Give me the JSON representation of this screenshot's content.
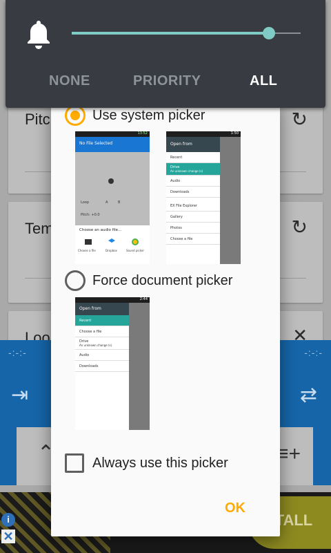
{
  "volume_panel": {
    "level": 0.86,
    "modes": [
      {
        "label": "NONE",
        "selected": false
      },
      {
        "label": "PRIORITY",
        "selected": false
      },
      {
        "label": "ALL",
        "selected": true
      }
    ],
    "accent": "#80cbc4"
  },
  "background": {
    "cards": [
      {
        "label": "Pitc",
        "icon": "refresh-icon"
      },
      {
        "label": "Tem",
        "icon": "refresh-icon"
      },
      {
        "label": "Loo",
        "icon": "close-icon"
      }
    ],
    "ad": {
      "install_label": "STALL"
    }
  },
  "dialog": {
    "options": [
      {
        "label": "Use system picker",
        "checked": true
      },
      {
        "label": "Force document picker",
        "checked": false
      }
    ],
    "checkbox_label": "Always use this picker",
    "ok_label": "OK",
    "accent": "#ffab00"
  },
  "previews": {
    "system_left": {
      "status_time": "13:52",
      "title": "No File Selected",
      "loop_label": "Loop",
      "a_label": "A",
      "b_label": "B",
      "pitch_label": "Pitch: +0.0",
      "chooser_title": "Choose an audio file...",
      "apps": [
        "Choose a file",
        "Dropbox",
        "Sound picker"
      ]
    },
    "system_right": {
      "status_time": "1:50",
      "title": "Open from",
      "items": [
        "Recent",
        "Drive",
        "Audio",
        "Downloads",
        "EX File Explorer",
        "Gallery",
        "Photos",
        "Choose a file"
      ],
      "drive_sub": "An unknown change (s)"
    },
    "document": {
      "status_time": "2:44",
      "title": "Open from",
      "items": [
        "Recent",
        "Choose a file",
        "Drive",
        "Audio",
        "Downloads"
      ],
      "drive_sub": "An unknown change (s)"
    }
  }
}
